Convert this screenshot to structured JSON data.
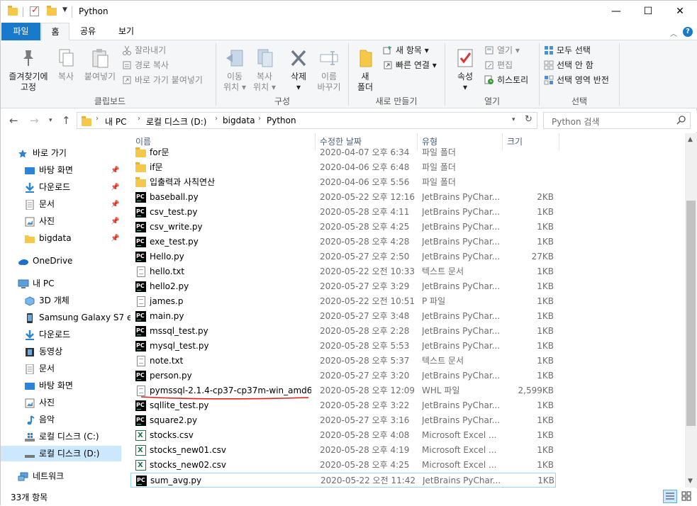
{
  "window": {
    "title": "Python",
    "controls": {
      "minimize": "—",
      "maximize": "☐",
      "close": "✕"
    }
  },
  "tabs": {
    "file": "파일",
    "home": "홈",
    "share": "공유",
    "view": "보기"
  },
  "ribbon": {
    "clipboard": {
      "label": "클립보드",
      "pin_line1": "즐겨찾기에",
      "pin_line2": "고정",
      "copy": "복사",
      "paste": "붙여넣기",
      "cut": "잘라내기",
      "copy_path": "경로 복사",
      "paste_shortcut": "바로 가기 붙여넣기"
    },
    "organize": {
      "label": "구성",
      "move_line1": "이동",
      "move_line2": "위치",
      "copy_line1": "복사",
      "copy_line2": "위치",
      "delete": "삭제",
      "rename_line1": "이름",
      "rename_line2": "바꾸기"
    },
    "new": {
      "label": "새로 만들기",
      "folder_line1": "새",
      "folder_line2": "폴더",
      "new_item": "새 항목",
      "easy_access": "빠른 연결"
    },
    "open": {
      "label": "열기",
      "properties": "속성",
      "open": "열기",
      "edit": "편집",
      "history": "히스토리"
    },
    "select": {
      "label": "선택",
      "select_all": "모두 선택",
      "select_none": "선택 안 함",
      "invert": "선택 영역 반전"
    }
  },
  "address": {
    "crumbs": [
      "내 PC",
      "로컬 디스크 (D:)",
      "bigdata",
      "Python"
    ],
    "search_placeholder": "Python 검색"
  },
  "nav": {
    "quick_access": "바로 가기",
    "quick_items": [
      "바탕 화면",
      "다운로드",
      "문서",
      "사진",
      "bigdata"
    ],
    "onedrive": "OneDrive",
    "this_pc": "내 PC",
    "pc_items": [
      "3D 개체",
      "Samsung Galaxy S7 e",
      "다운로드",
      "동영상",
      "문서",
      "바탕 화면",
      "사진",
      "음악",
      "로컬 디스크 (C:)",
      "로컬 디스크 (D:)"
    ],
    "network": "네트워크"
  },
  "columns": {
    "name": "이름",
    "date": "수정한 날짜",
    "type": "유형",
    "size": "크기"
  },
  "files": [
    {
      "name": "for문",
      "date": "2020-04-07 오후 6:34",
      "type": "파일 폴더",
      "size": "",
      "icon": "folder"
    },
    {
      "name": "if문",
      "date": "2020-04-06 오후 6:48",
      "type": "파일 폴더",
      "size": "",
      "icon": "folder"
    },
    {
      "name": "입출력과 사칙연산",
      "date": "2020-04-06 오후 5:56",
      "type": "파일 폴더",
      "size": "",
      "icon": "folder"
    },
    {
      "name": "baseball.py",
      "date": "2020-05-22 오후 12:16",
      "type": "JetBrains PyChar...",
      "size": "2KB",
      "icon": "pycharm"
    },
    {
      "name": "csv_test.py",
      "date": "2020-05-28 오후 4:11",
      "type": "JetBrains PyChar...",
      "size": "1KB",
      "icon": "pycharm"
    },
    {
      "name": "csv_write.py",
      "date": "2020-05-28 오후 4:25",
      "type": "JetBrains PyChar...",
      "size": "1KB",
      "icon": "pycharm"
    },
    {
      "name": "exe_test.py",
      "date": "2020-05-28 오후 4:28",
      "type": "JetBrains PyChar...",
      "size": "1KB",
      "icon": "pycharm"
    },
    {
      "name": "Hello.py",
      "date": "2020-05-27 오후 2:50",
      "type": "JetBrains PyChar...",
      "size": "27KB",
      "icon": "pycharm"
    },
    {
      "name": "hello.txt",
      "date": "2020-05-22 오전 10:33",
      "type": "텍스트 문서",
      "size": "1KB",
      "icon": "text"
    },
    {
      "name": "hello2.py",
      "date": "2020-05-27 오후 3:29",
      "type": "JetBrains PyChar...",
      "size": "1KB",
      "icon": "pycharm"
    },
    {
      "name": "james.p",
      "date": "2020-05-22 오전 10:51",
      "type": "P 파일",
      "size": "1KB",
      "icon": "text"
    },
    {
      "name": "main.py",
      "date": "2020-05-27 오후 3:48",
      "type": "JetBrains PyChar...",
      "size": "1KB",
      "icon": "pycharm"
    },
    {
      "name": "mssql_test.py",
      "date": "2020-05-28 오후 2:28",
      "type": "JetBrains PyChar...",
      "size": "1KB",
      "icon": "pycharm"
    },
    {
      "name": "mysql_test.py",
      "date": "2020-05-28 오후 5:53",
      "type": "JetBrains PyChar...",
      "size": "1KB",
      "icon": "pycharm"
    },
    {
      "name": "note.txt",
      "date": "2020-05-28 오후 5:37",
      "type": "텍스트 문서",
      "size": "1KB",
      "icon": "text"
    },
    {
      "name": "person.py",
      "date": "2020-05-27 오후 3:20",
      "type": "JetBrains PyChar...",
      "size": "1KB",
      "icon": "pycharm"
    },
    {
      "name": "pymssql-2.1.4-cp37-cp37m-win_amd6...",
      "date": "2020-05-28 오후 12:09",
      "type": "WHL 파일",
      "size": "2,599KB",
      "icon": "text"
    },
    {
      "name": "sqllite_test.py",
      "date": "2020-05-28 오후 3:22",
      "type": "JetBrains PyChar...",
      "size": "1KB",
      "icon": "pycharm"
    },
    {
      "name": "square2.py",
      "date": "2020-05-27 오후 3:16",
      "type": "JetBrains PyChar...",
      "size": "1KB",
      "icon": "pycharm"
    },
    {
      "name": "stocks.csv",
      "date": "2020-05-28 오후 4:08",
      "type": "Microsoft Excel ...",
      "size": "1KB",
      "icon": "excel"
    },
    {
      "name": "stocks_new01.csv",
      "date": "2020-05-28 오후 4:19",
      "type": "Microsoft Excel ...",
      "size": "1KB",
      "icon": "excel"
    },
    {
      "name": "stocks_new02.csv",
      "date": "2020-05-28 오후 4:25",
      "type": "Microsoft Excel ...",
      "size": "1KB",
      "icon": "excel"
    },
    {
      "name": "sum_avg.py",
      "date": "2020-05-22 오전 11:42",
      "type": "JetBrains PyChar...",
      "size": "1KB",
      "icon": "pycharm"
    }
  ],
  "status": {
    "count": "33개 항목"
  },
  "colors": {
    "accent": "#1979ca",
    "selection": "#cce8ff",
    "annotation_red": "#e0201a"
  }
}
